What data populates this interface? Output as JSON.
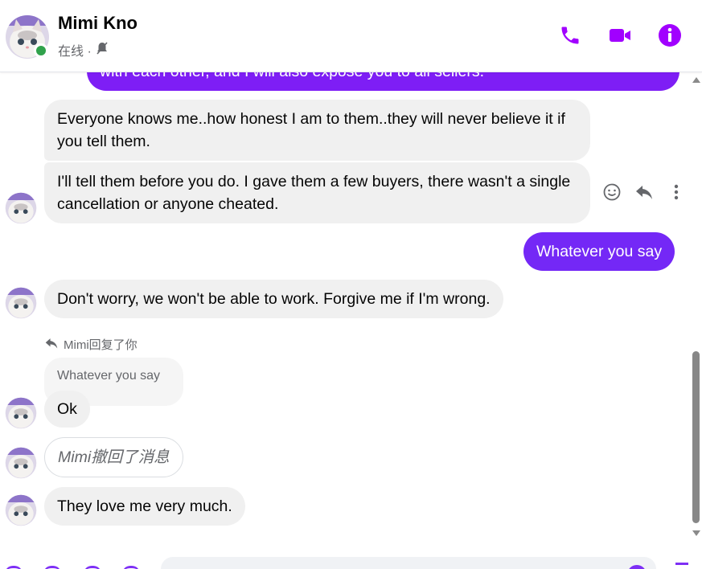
{
  "header": {
    "name": "Mimi Kno",
    "status": "在线 ·",
    "icons": [
      "phone-icon",
      "video-icon",
      "info-icon",
      "muted-bell-icon"
    ],
    "accent": "#a100ff"
  },
  "messages": {
    "top_partial": "with each other, and I will also expose you to all sellers.",
    "m1": "Everyone knows me..how honest I am to them..they will never believe it if you tell them.",
    "m2": "I'll tell them before you do. I gave them a few buyers, there wasn't a single cancellation or anyone cheated.",
    "m3": "Whatever you say",
    "m4": "Don't worry, we won't be able to work. Forgive me if I'm wrong.",
    "reply_label": "Mimi回复了你",
    "quoted": "Whatever you say",
    "m5": "Ok",
    "m6": "Mimi撤回了消息",
    "m7": "They love me very much."
  },
  "actions": [
    "emoji-react-icon",
    "reply-icon",
    "more-icon"
  ],
  "colors": {
    "outgoing": "#7e2ff5",
    "incoming": "#f0f0f0",
    "online": "#31a24c"
  }
}
